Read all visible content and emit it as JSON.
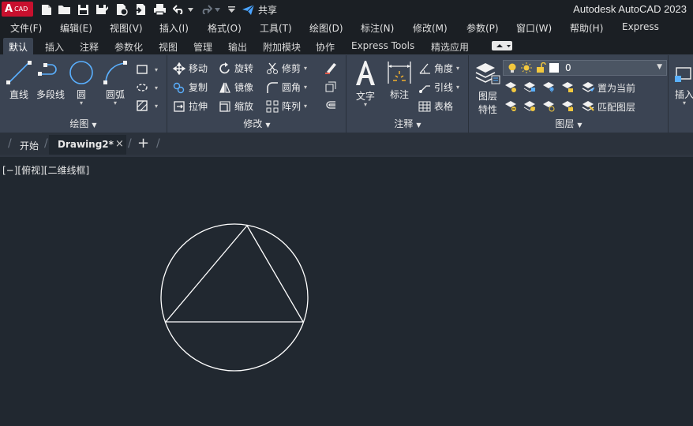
{
  "titlebar": {
    "logo_letter": "A",
    "logo_sub": "CAD",
    "share": "共享",
    "window_title": "Autodesk AutoCAD 2023"
  },
  "menubar": {
    "items": [
      "文件(F)",
      "编辑(E)",
      "视图(V)",
      "插入(I)",
      "格式(O)",
      "工具(T)",
      "绘图(D)",
      "标注(N)",
      "修改(M)",
      "参数(P)",
      "窗口(W)",
      "帮助(H)",
      "Express"
    ]
  },
  "ribbon_tabs": {
    "items": [
      "默认",
      "插入",
      "注释",
      "参数化",
      "视图",
      "管理",
      "输出",
      "附加模块",
      "协作",
      "Express Tools",
      "精选应用"
    ],
    "active": "默认"
  },
  "panels": {
    "draw": {
      "title": "绘图",
      "line": "直线",
      "polyline": "多段线",
      "circle": "圆",
      "arc": "圆弧"
    },
    "modify": {
      "title": "修改",
      "move": "移动",
      "rotate": "旋转",
      "trim": "修剪",
      "copy": "复制",
      "mirror": "镜像",
      "fillet": "圆角",
      "stretch": "拉伸",
      "scale": "缩放",
      "array": "阵列"
    },
    "annotation": {
      "title": "注释",
      "text": "文字",
      "dimension": "标注",
      "angle": "角度",
      "leader": "引线",
      "table": "表格"
    },
    "layers": {
      "title": "图层",
      "properties_line1": "图层",
      "properties_line2": "特性",
      "current_layer": "0",
      "make_current": "置为当前",
      "match_layer": "匹配图层"
    },
    "insert": {
      "label": "插入"
    }
  },
  "filetabs": {
    "start": "开始",
    "drawing": "Drawing2*",
    "close": "×",
    "new": "+"
  },
  "viewport": {
    "label": "[−][俯视][二维线框]"
  },
  "colors": {
    "accent": "#c8102e",
    "ribbon_bg": "#3b4453",
    "canvas_bg": "#212830",
    "share_icon": "#4aa3ff"
  }
}
